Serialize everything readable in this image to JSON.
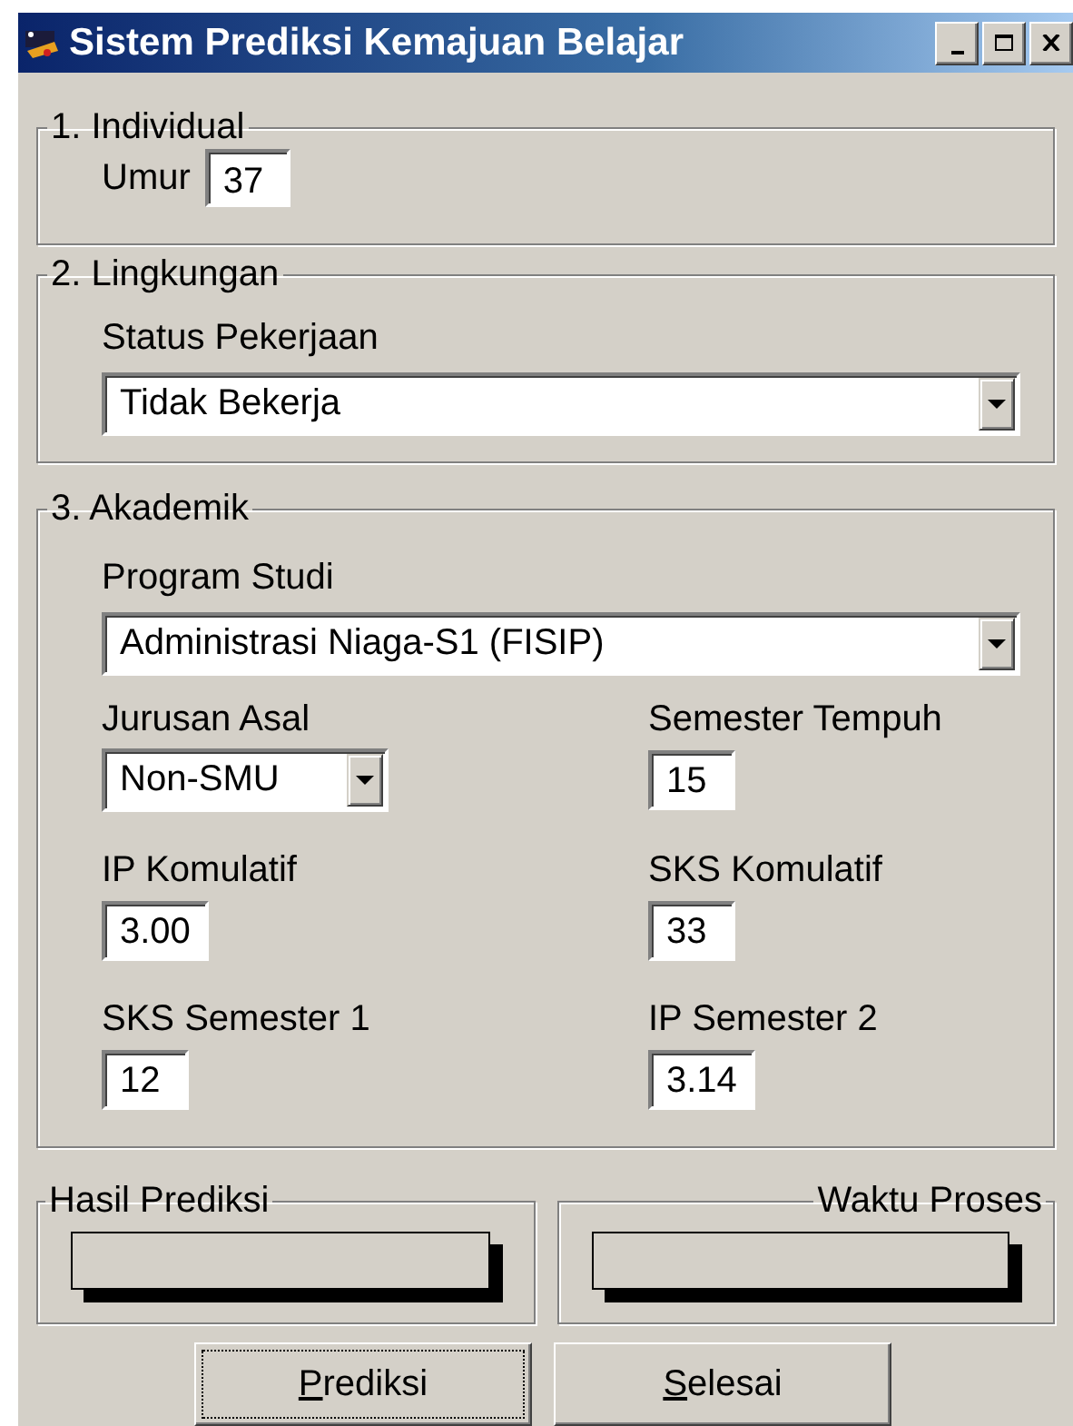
{
  "window": {
    "title": "Sistem Prediksi Kemajuan Belajar"
  },
  "title_buttons": [
    {
      "kind": "minimize"
    },
    {
      "kind": "maximize"
    },
    {
      "kind": "close"
    }
  ],
  "individual": {
    "legend": "1. Individual",
    "umur": {
      "label": "Umur",
      "value": "37"
    }
  },
  "lingkungan": {
    "legend": "2. Lingkungan",
    "status_pekerjaan": {
      "label": "Status Pekerjaan",
      "value": "Tidak Bekerja"
    }
  },
  "akademik": {
    "legend": "3. Akademik",
    "program_studi": {
      "label": "Program Studi",
      "value": "Administrasi Niaga-S1 (FISIP)"
    },
    "fields": [
      {
        "kind": "combo",
        "label": "Jurusan Asal",
        "value": "Non-SMU"
      },
      {
        "kind": "text",
        "label": "Semester Tempuh",
        "value": "15"
      },
      {
        "kind": "text",
        "label": "IP Komulatif",
        "value": "3.00"
      },
      {
        "kind": "text",
        "label": "SKS Komulatif",
        "value": "33"
      },
      {
        "kind": "text",
        "label": "SKS Semester 1",
        "value": "12"
      },
      {
        "kind": "text",
        "label": "IP Semester 2",
        "value": "3.14"
      }
    ]
  },
  "results": [
    {
      "legend": "Hasil Prediksi",
      "legend_right": false
    },
    {
      "legend": "Waktu Proses",
      "legend_right": true
    }
  ],
  "buttons": [
    {
      "label": "Prediksi",
      "focused": true,
      "mnemonic_underlined": true
    },
    {
      "label": "Selesai",
      "focused": false,
      "mnemonic_underlined": true
    }
  ]
}
